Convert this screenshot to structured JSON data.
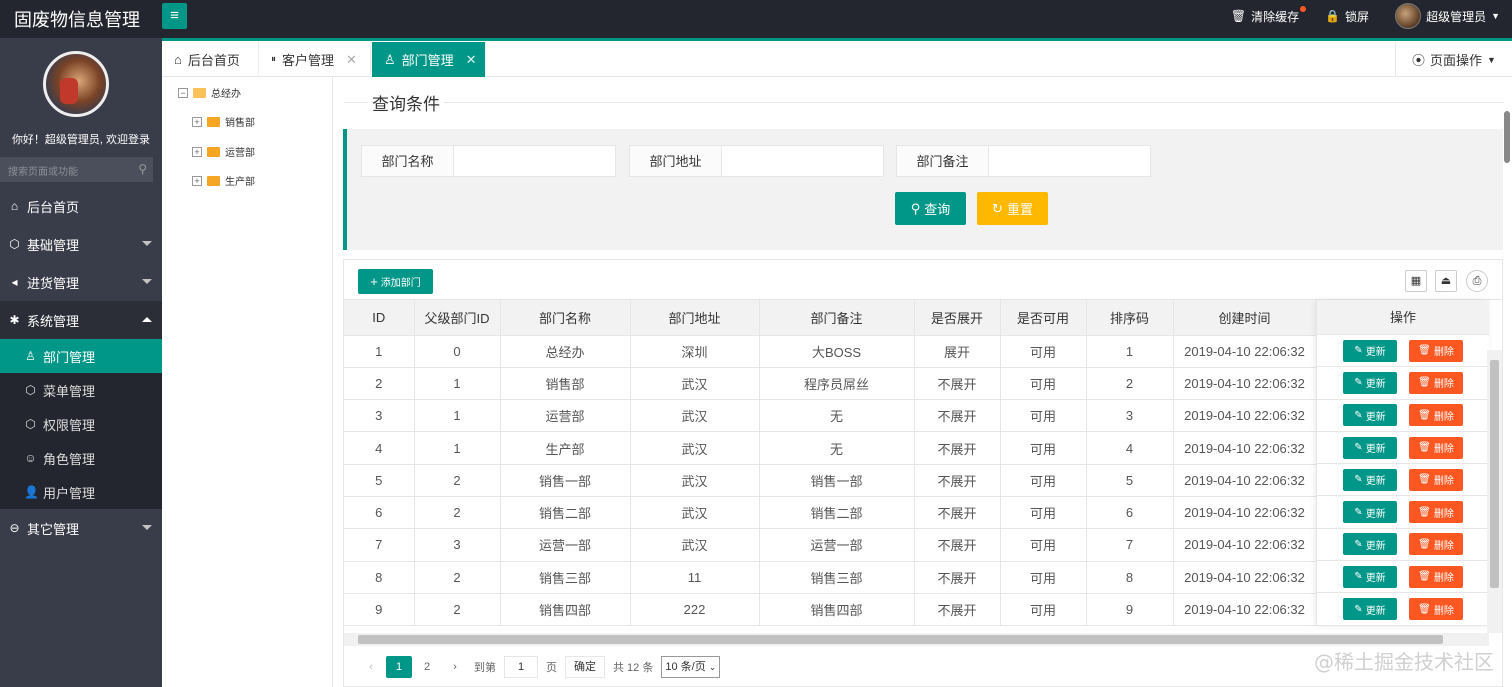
{
  "app": {
    "title": "固废物信息管理",
    "menu_toggle_icon": "≡"
  },
  "header": {
    "clear_cache": "清除缓存",
    "lock": "锁屏",
    "user": "超级管理员"
  },
  "sidebar": {
    "greeting": "你好！超级管理员, 欢迎登录",
    "search_placeholder": "搜索页面或功能",
    "home": "后台首页",
    "groups": [
      {
        "label": "基础管理"
      },
      {
        "label": "进货管理"
      },
      {
        "label": "系统管理"
      },
      {
        "label": "其它管理"
      }
    ],
    "sub_items": [
      {
        "label": "部门管理"
      },
      {
        "label": "菜单管理"
      },
      {
        "label": "权限管理"
      },
      {
        "label": "角色管理"
      },
      {
        "label": "用户管理"
      }
    ]
  },
  "tabs": [
    {
      "label": "后台首页"
    },
    {
      "label": "客户管理"
    },
    {
      "label": "部门管理"
    }
  ],
  "tab_close": "✕",
  "page_ops": "页面操作",
  "tree": {
    "root": "总经办",
    "children": [
      "销售部",
      "运营部",
      "生产部"
    ]
  },
  "query": {
    "title": "查询条件",
    "fields": [
      {
        "label": "部门名称",
        "value": ""
      },
      {
        "label": "部门地址",
        "value": ""
      },
      {
        "label": "部门备注",
        "value": ""
      }
    ],
    "search_btn": "查询",
    "reset_btn": "重置"
  },
  "table": {
    "add_btn": "添加部门",
    "columns": [
      "ID",
      "父级部门ID",
      "部门名称",
      "部门地址",
      "部门备注",
      "是否展开",
      "是否可用",
      "排序码",
      "创建时间",
      "操作"
    ],
    "rows": [
      [
        "1",
        "0",
        "总经办",
        "深圳",
        "大BOSS",
        "展开",
        "可用",
        "1",
        "2019-04-10 22:06:32"
      ],
      [
        "2",
        "1",
        "销售部",
        "武汉",
        "程序员屌丝",
        "不展开",
        "可用",
        "2",
        "2019-04-10 22:06:32"
      ],
      [
        "3",
        "1",
        "运营部",
        "武汉",
        "无",
        "不展开",
        "可用",
        "3",
        "2019-04-10 22:06:32"
      ],
      [
        "4",
        "1",
        "生产部",
        "武汉",
        "无",
        "不展开",
        "可用",
        "4",
        "2019-04-10 22:06:32"
      ],
      [
        "5",
        "2",
        "销售一部",
        "武汉",
        "销售一部",
        "不展开",
        "可用",
        "5",
        "2019-04-10 22:06:32"
      ],
      [
        "6",
        "2",
        "销售二部",
        "武汉",
        "销售二部",
        "不展开",
        "可用",
        "6",
        "2019-04-10 22:06:32"
      ],
      [
        "7",
        "3",
        "运营一部",
        "武汉",
        "运营一部",
        "不展开",
        "可用",
        "7",
        "2019-04-10 22:06:32"
      ],
      [
        "8",
        "2",
        "销售三部",
        "11",
        "销售三部",
        "不展开",
        "可用",
        "8",
        "2019-04-10 22:06:32"
      ],
      [
        "9",
        "2",
        "销售四部",
        "222",
        "销售四部",
        "不展开",
        "可用",
        "9",
        "2019-04-10 22:06:32"
      ]
    ],
    "edit_btn": "更新",
    "delete_btn": "删除"
  },
  "pager": {
    "pages": [
      "1",
      "2"
    ],
    "current": "1",
    "goto_label": "到第",
    "goto_value": "1",
    "page_unit": "页",
    "confirm": "确定",
    "total": "共 12 条",
    "page_size": "10 条/页"
  },
  "watermark": "@稀土掘金技术社区",
  "colors": {
    "primary": "#009688",
    "warn": "#ffb800",
    "danger": "#ff5722",
    "dark": "#393d49",
    "header": "#23262e"
  }
}
